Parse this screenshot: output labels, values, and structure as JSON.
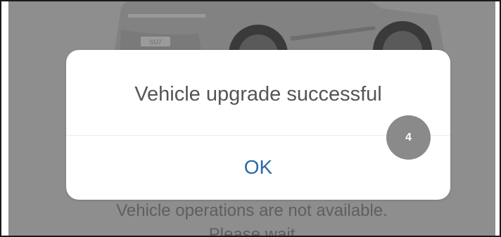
{
  "background": {
    "line1": "Vehicle operations are not available.",
    "line2": "Please wait"
  },
  "dialog": {
    "message": "Vehicle upgrade successful",
    "ok_label": "OK"
  },
  "step_badge": "4",
  "colors": {
    "overlay": "#8e8e8e",
    "dialog_bg": "#ffffff",
    "message_text": "#555555",
    "ok_text": "#2f67a6",
    "badge_bg": "#8a8a8a"
  }
}
